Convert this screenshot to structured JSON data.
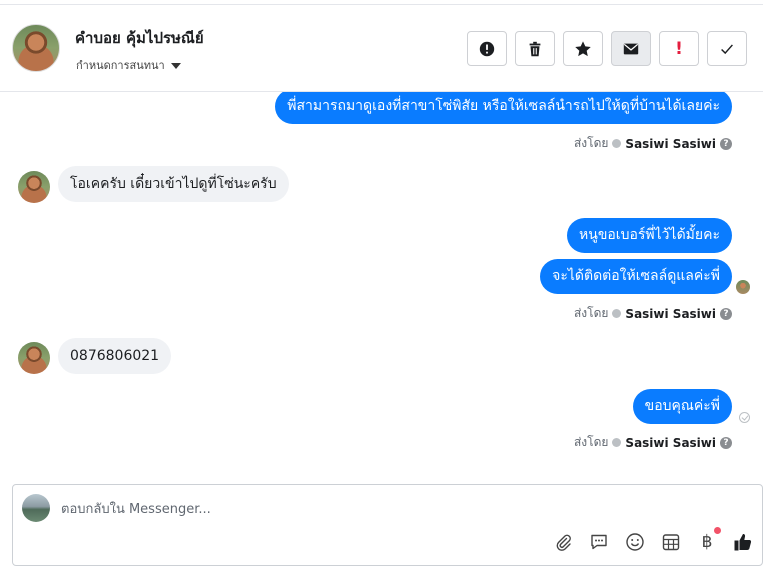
{
  "header": {
    "contact_name": "คำบอย คุ้มไปรษณีย์",
    "assign_label": "กำหนดการสนทนา",
    "toolbar": [
      {
        "icon": "alert-circle-icon"
      },
      {
        "icon": "trash-icon"
      },
      {
        "icon": "star-icon"
      },
      {
        "icon": "envelope-icon"
      },
      {
        "icon": "exclamation-icon",
        "text": "!"
      },
      {
        "icon": "check-icon"
      }
    ]
  },
  "messages": {
    "m1": "พี่สามารถมาดูเองที่สาขาโซ่พิสัย หรือให้เซลล์นำรถไปให้ดูที่บ้านได้เลยค่ะ",
    "m2": "โอเคครับ เดี๋ยวเข้าไปดูที่โซ่นะครับ",
    "m3": "หนูขอเบอร์พี่ไว้ได้มั้ยคะ",
    "m4": "จะได้ติดต่อให้เซลล์ดูแลค่ะพี่",
    "m5": "0876806021",
    "m6": "ขอบคุณค่ะพี่"
  },
  "sent_by": {
    "prefix": "ส่งโดย",
    "name": "Sasiwi Sasiwi"
  },
  "composer": {
    "placeholder": "ตอบกลับใน Messenger...",
    "value": "",
    "baht": "฿"
  },
  "colors": {
    "accent": "#0a7cff",
    "incoming_bg": "#f0f2f5",
    "danger": "#e41e3f"
  }
}
